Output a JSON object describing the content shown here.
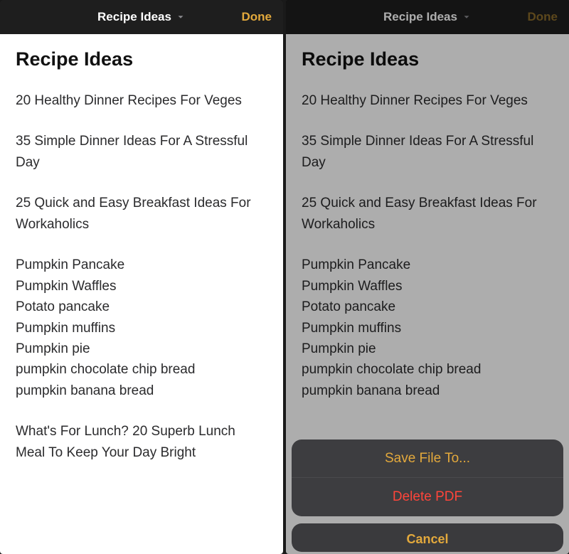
{
  "nav": {
    "title": "Recipe Ideas",
    "done_label": "Done"
  },
  "note": {
    "title": "Recipe Ideas",
    "blocks": [
      "20 Healthy Dinner Recipes For Veges",
      "35 Simple Dinner Ideas For A Stressful Day",
      "25 Quick and Easy Breakfast Ideas For Workaholics"
    ],
    "list": [
      "Pumpkin Pancake",
      "Pumpkin Waffles",
      "Potato pancake",
      "Pumpkin muffins",
      "Pumpkin pie",
      "pumpkin chocolate chip bread",
      "pumpkin banana bread"
    ],
    "final_block": "What's For Lunch? 20 Superb Lunch Meal To Keep Your Day Bright"
  },
  "sheet": {
    "save_label": "Save File To...",
    "delete_label": "Delete PDF",
    "cancel_label": "Cancel"
  }
}
